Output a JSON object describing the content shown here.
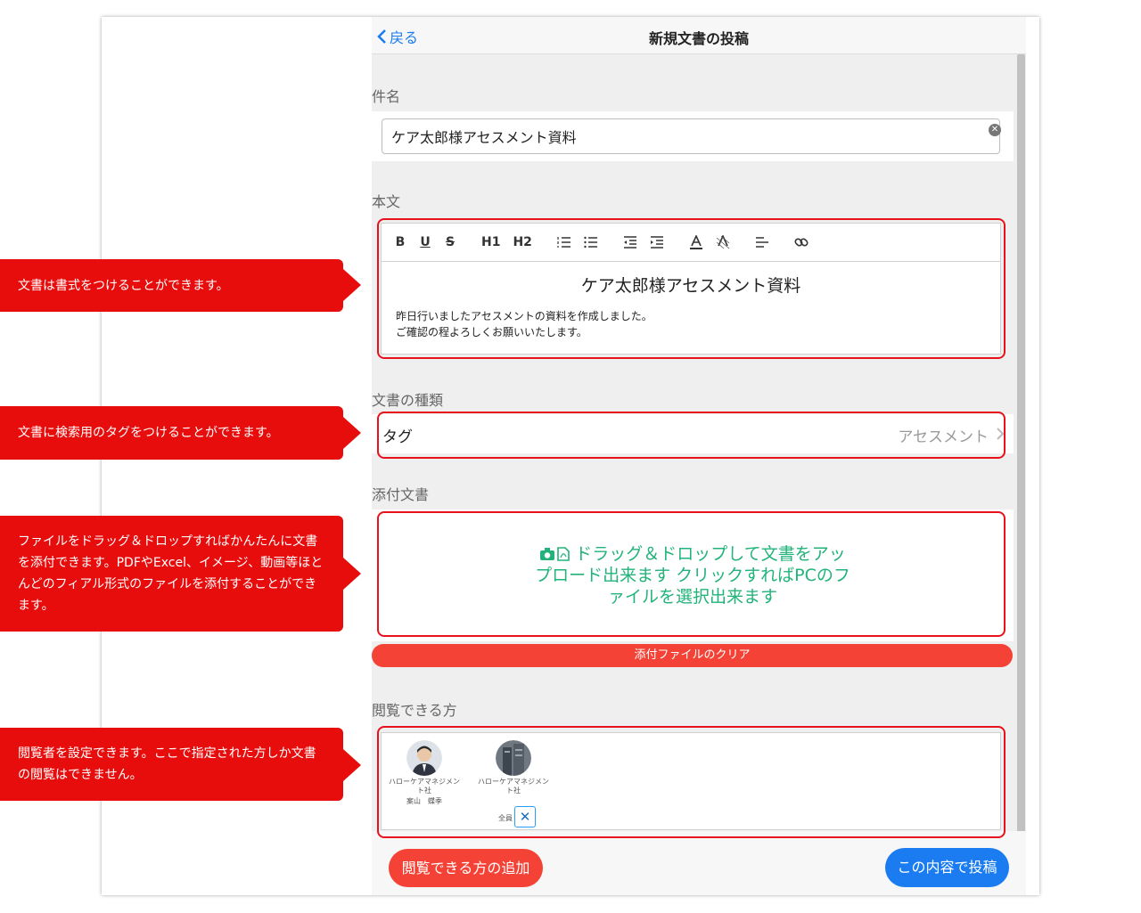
{
  "navbar": {
    "back_label": "戻る",
    "title": "新規文書の投稿"
  },
  "subject": {
    "label": "件名",
    "value": "ケア太郎様アセスメント資料"
  },
  "body": {
    "label": "本文",
    "toolbar": [
      "B",
      "U",
      "S",
      "H1",
      "H2"
    ],
    "heading": "ケア太郎様アセスメント資料",
    "lines": [
      "昨日行いましたアセスメントの資料を作成しました。",
      "ご確認の程よろしくお願いいたします。"
    ]
  },
  "doc_type": {
    "label": "文書の種類",
    "tag_label": "タグ",
    "tag_value": "アセスメント"
  },
  "attachment": {
    "label": "添付文書",
    "drop_text": "ドラッグ＆ドロップして文書をアップロード出来ます クリックすればPCのファイルを選択出来ます",
    "clear_label": "添付ファイルのクリア"
  },
  "viewers": {
    "label": "閲覧できる方",
    "items": [
      {
        "org": "ハローケアマネジメント社",
        "name": "案山　蝶季"
      },
      {
        "org": "ハローケアマネジメント社",
        "name": "全員"
      }
    ]
  },
  "bottom": {
    "add_viewer_label": "閲覧できる方の追加",
    "post_label": "この内容で投稿"
  },
  "callouts": [
    "文書は書式をつけることができます。",
    "文書に検索用のタグをつけることができます。",
    "ファイルをドラッグ＆ドロップすればかんたんに文書を添付できます。PDFやExcel、イメージ、動画等ほとんどのフィアル形式のファイルを添付することができます。",
    "閲覧者を設定できます。ここで指定された方しか文書の閲覧はできません。"
  ],
  "colors": {
    "accent": "#1a7cf0",
    "danger": "#f44336",
    "callout": "#e80d0d",
    "dropzone_text": "#22b37a"
  }
}
